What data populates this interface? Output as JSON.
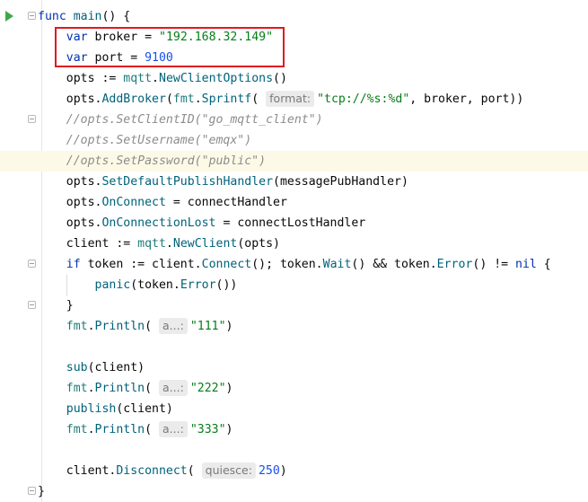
{
  "code_lines": [
    {
      "tokens": [
        {
          "t": "func ",
          "c": "kw"
        },
        {
          "t": "main",
          "c": "fn"
        },
        {
          "t": "() {",
          "c": "pl"
        }
      ]
    },
    {
      "tokens": [
        {
          "t": "    ",
          "c": "pl"
        },
        {
          "t": "var ",
          "c": "kw"
        },
        {
          "t": "broker = ",
          "c": "pl"
        },
        {
          "t": "\"192.168.32.149\"",
          "c": "str"
        }
      ]
    },
    {
      "tokens": [
        {
          "t": "    ",
          "c": "pl"
        },
        {
          "t": "var ",
          "c": "kw"
        },
        {
          "t": "port = ",
          "c": "pl"
        },
        {
          "t": "9100",
          "c": "num"
        }
      ]
    },
    {
      "tokens": [
        {
          "t": "    opts := ",
          "c": "pl"
        },
        {
          "t": "mqtt",
          "c": "pk"
        },
        {
          "t": ".",
          "c": "pl"
        },
        {
          "t": "NewClientOptions",
          "c": "mt"
        },
        {
          "t": "()",
          "c": "pl"
        }
      ]
    },
    {
      "tokens": [
        {
          "t": "    opts.",
          "c": "pl"
        },
        {
          "t": "AddBroker",
          "c": "mt"
        },
        {
          "t": "(",
          "c": "pl"
        },
        {
          "t": "fmt",
          "c": "pk"
        },
        {
          "t": ".",
          "c": "pl"
        },
        {
          "t": "Sprintf",
          "c": "mt"
        },
        {
          "t": "( ",
          "c": "pl"
        },
        {
          "t": "format:",
          "c": "hint"
        },
        {
          "t": "\"tcp://%s:%d\"",
          "c": "str"
        },
        {
          "t": ", broker, port))",
          "c": "pl"
        }
      ]
    },
    {
      "tokens": [
        {
          "t": "    //opts.SetClientID(\"go_mqtt_client\")",
          "c": "cmt"
        }
      ]
    },
    {
      "tokens": [
        {
          "t": "    //opts.SetUsername(\"emqx\")",
          "c": "cmt"
        }
      ]
    },
    {
      "hl": true,
      "tokens": [
        {
          "t": "    //opts.SetPassword(\"public\")",
          "c": "cmt"
        }
      ]
    },
    {
      "tokens": [
        {
          "t": "    opts.",
          "c": "pl"
        },
        {
          "t": "SetDefaultPublishHandler",
          "c": "mt"
        },
        {
          "t": "(messagePubHandler)",
          "c": "pl"
        }
      ]
    },
    {
      "tokens": [
        {
          "t": "    opts.",
          "c": "pl"
        },
        {
          "t": "OnConnect",
          "c": "mt"
        },
        {
          "t": " = connectHandler",
          "c": "pl"
        }
      ]
    },
    {
      "tokens": [
        {
          "t": "    opts.",
          "c": "pl"
        },
        {
          "t": "OnConnectionLost",
          "c": "mt"
        },
        {
          "t": " = connectLostHandler",
          "c": "pl"
        }
      ]
    },
    {
      "tokens": [
        {
          "t": "    client := ",
          "c": "pl"
        },
        {
          "t": "mqtt",
          "c": "pk"
        },
        {
          "t": ".",
          "c": "pl"
        },
        {
          "t": "NewClient",
          "c": "mt"
        },
        {
          "t": "(opts)",
          "c": "pl"
        }
      ]
    },
    {
      "tokens": [
        {
          "t": "    ",
          "c": "pl"
        },
        {
          "t": "if ",
          "c": "kw"
        },
        {
          "t": "token := client.",
          "c": "pl"
        },
        {
          "t": "Connect",
          "c": "mt"
        },
        {
          "t": "(); token.",
          "c": "pl"
        },
        {
          "t": "Wait",
          "c": "mt"
        },
        {
          "t": "() && token.",
          "c": "pl"
        },
        {
          "t": "Error",
          "c": "mt"
        },
        {
          "t": "() != ",
          "c": "pl"
        },
        {
          "t": "nil",
          "c": "kw"
        },
        {
          "t": " {",
          "c": "pl"
        }
      ]
    },
    {
      "tokens": [
        {
          "t": "        ",
          "c": "pl"
        },
        {
          "t": "panic",
          "c": "fn"
        },
        {
          "t": "(token.",
          "c": "pl"
        },
        {
          "t": "Error",
          "c": "mt"
        },
        {
          "t": "())",
          "c": "pl"
        }
      ]
    },
    {
      "tokens": [
        {
          "t": "    }",
          "c": "pl"
        }
      ]
    },
    {
      "tokens": [
        {
          "t": "    ",
          "c": "pl"
        },
        {
          "t": "fmt",
          "c": "pk"
        },
        {
          "t": ".",
          "c": "pl"
        },
        {
          "t": "Println",
          "c": "mt"
        },
        {
          "t": "( ",
          "c": "pl"
        },
        {
          "t": "a...:",
          "c": "hint"
        },
        {
          "t": "\"111\"",
          "c": "str"
        },
        {
          "t": ")",
          "c": "pl"
        }
      ]
    },
    {
      "tokens": []
    },
    {
      "tokens": [
        {
          "t": "    ",
          "c": "pl"
        },
        {
          "t": "sub",
          "c": "fn"
        },
        {
          "t": "(client)",
          "c": "pl"
        }
      ]
    },
    {
      "tokens": [
        {
          "t": "    ",
          "c": "pl"
        },
        {
          "t": "fmt",
          "c": "pk"
        },
        {
          "t": ".",
          "c": "pl"
        },
        {
          "t": "Println",
          "c": "mt"
        },
        {
          "t": "( ",
          "c": "pl"
        },
        {
          "t": "a...:",
          "c": "hint"
        },
        {
          "t": "\"222\"",
          "c": "str"
        },
        {
          "t": ")",
          "c": "pl"
        }
      ]
    },
    {
      "tokens": [
        {
          "t": "    ",
          "c": "pl"
        },
        {
          "t": "publish",
          "c": "fn"
        },
        {
          "t": "(client)",
          "c": "pl"
        }
      ]
    },
    {
      "tokens": [
        {
          "t": "    ",
          "c": "pl"
        },
        {
          "t": "fmt",
          "c": "pk"
        },
        {
          "t": ".",
          "c": "pl"
        },
        {
          "t": "Println",
          "c": "mt"
        },
        {
          "t": "( ",
          "c": "pl"
        },
        {
          "t": "a...:",
          "c": "hint"
        },
        {
          "t": "\"333\"",
          "c": "str"
        },
        {
          "t": ")",
          "c": "pl"
        }
      ]
    },
    {
      "tokens": []
    },
    {
      "tokens": [
        {
          "t": "    client.",
          "c": "pl"
        },
        {
          "t": "Disconnect",
          "c": "mt"
        },
        {
          "t": "( ",
          "c": "pl"
        },
        {
          "t": "quiesce:",
          "c": "hint"
        },
        {
          "t": "250",
          "c": "num"
        },
        {
          "t": ")",
          "c": "pl"
        }
      ]
    },
    {
      "tokens": [
        {
          "t": "}",
          "c": "pl"
        }
      ]
    }
  ],
  "colors": {
    "keyword": "#0033b3",
    "string": "#067d17",
    "number": "#1750eb",
    "comment": "#8c8c8c",
    "highlight_box": "#e0191f",
    "run_icon": "#3daa4a"
  }
}
